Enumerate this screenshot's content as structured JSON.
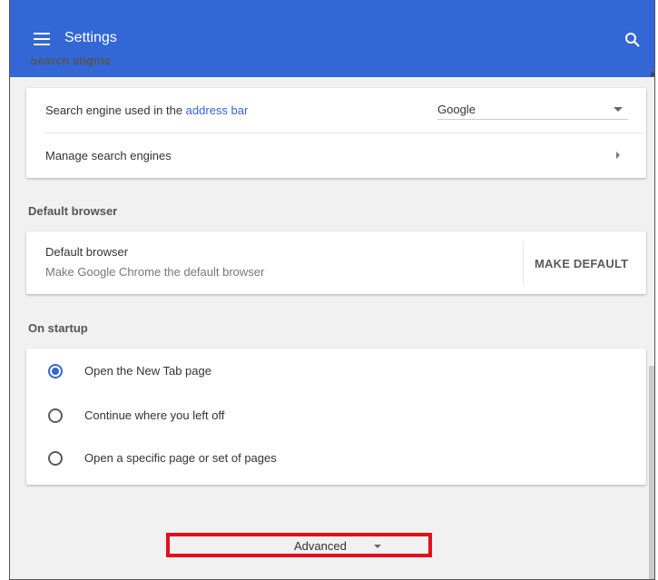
{
  "appbar": {
    "title": "Settings",
    "color": "#3367d6"
  },
  "sections": {
    "search_engine": {
      "heading": "Search engine",
      "row_label_prefix": "Search engine used in the ",
      "row_label_link": "address bar",
      "select_value": "Google",
      "manage_label": "Manage search engines"
    },
    "default_browser": {
      "heading": "Default browser",
      "title": "Default browser",
      "subtitle": "Make Google Chrome the default browser",
      "button": "MAKE DEFAULT"
    },
    "on_startup": {
      "heading": "On startup",
      "options": [
        {
          "label": "Open the New Tab page",
          "checked": true
        },
        {
          "label": "Continue where you left off",
          "checked": false
        },
        {
          "label": "Open a specific page or set of pages",
          "checked": false
        }
      ]
    }
  },
  "advanced": {
    "label": "Advanced"
  },
  "icons": {
    "menu": "hamburger-menu-icon",
    "search": "search-icon",
    "dropdown": "chevron-down-icon",
    "submenu": "chevron-right-icon"
  },
  "colors": {
    "accent": "#3367d6",
    "highlight_border": "#e0121b"
  }
}
